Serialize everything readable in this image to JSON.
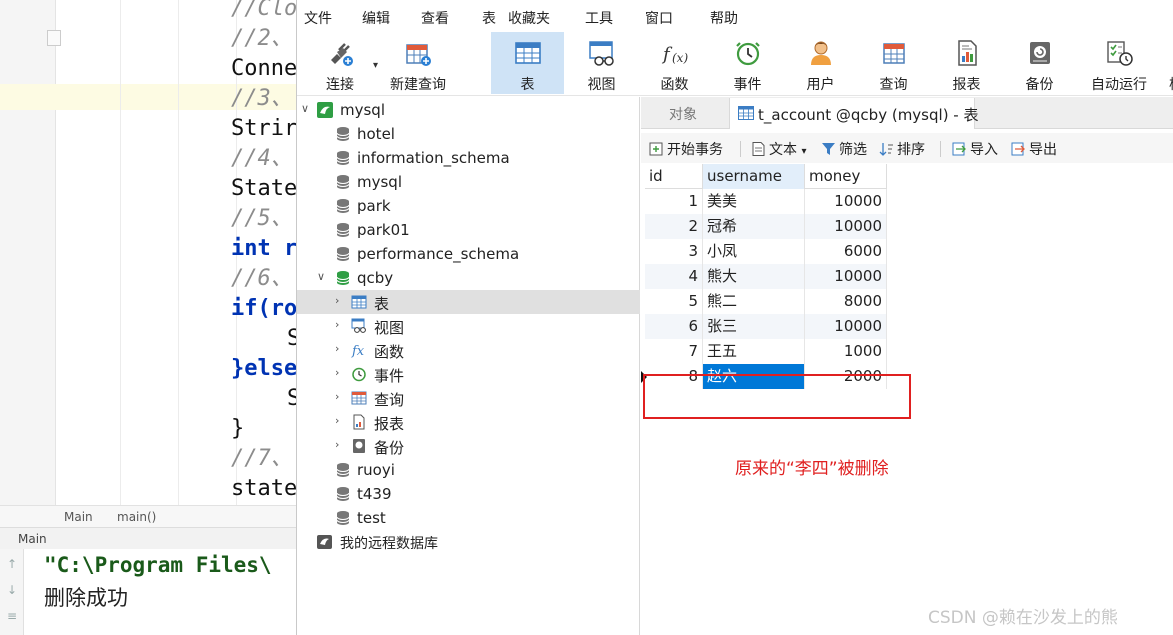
{
  "ide": {
    "code_lines": [
      "//Clo",
      "//2、",
      "Conne",
      "//3、",
      "Strir",
      "//4、",
      "State",
      "//5、",
      "int r",
      "//6、",
      "if(ro",
      "S",
      "}else",
      "S",
      "}",
      "//7、",
      "state"
    ],
    "breadcrumb": [
      "Main",
      "main()"
    ],
    "run_tab": "Main",
    "console_path": "\"C:\\Program Files\\",
    "console_msg": "删除成功"
  },
  "menubar": [
    "文件",
    "编辑",
    "查看",
    "表",
    "收藏夹",
    "工具",
    "窗口",
    "帮助"
  ],
  "toolbar": [
    {
      "label": "连接",
      "icon": "connect-icon"
    },
    {
      "label": "新建查询",
      "icon": "new-query-icon"
    },
    {
      "label": "表",
      "icon": "table-icon",
      "active": true
    },
    {
      "label": "视图",
      "icon": "view-icon"
    },
    {
      "label": "函数",
      "icon": "function-icon"
    },
    {
      "label": "事件",
      "icon": "event-clock-icon"
    },
    {
      "label": "用户",
      "icon": "user-icon"
    },
    {
      "label": "查询",
      "icon": "query-icon"
    },
    {
      "label": "报表",
      "icon": "report-icon"
    },
    {
      "label": "备份",
      "icon": "backup-icon"
    },
    {
      "label": "自动运行",
      "icon": "automation-icon"
    },
    {
      "label": "核",
      "icon": "model-icon"
    }
  ],
  "tree": {
    "connection": "mysql",
    "databases": [
      "hotel",
      "information_schema",
      "mysql",
      "park",
      "park01",
      "performance_schema",
      "qcby"
    ],
    "qcby_children": [
      "表",
      "视图",
      "函数",
      "事件",
      "查询",
      "报表",
      "备份"
    ],
    "databases_after": [
      "ruoyi",
      "t439",
      "test"
    ],
    "remote": "我的远程数据库"
  },
  "tabs": {
    "objects": "对象",
    "active_title": "t_account @qcby (mysql) - 表"
  },
  "subtoolbar": {
    "begin_tx": "开始事务",
    "text": "文本",
    "filter": "筛选",
    "sort": "排序",
    "import": "导入",
    "export": "导出"
  },
  "table": {
    "columns": [
      "id",
      "username",
      "money"
    ],
    "rows": [
      [
        "1",
        "美美",
        "10000"
      ],
      [
        "2",
        "冠希",
        "10000"
      ],
      [
        "3",
        "小凤",
        "6000"
      ],
      [
        "4",
        "熊大",
        "10000"
      ],
      [
        "5",
        "熊二",
        "8000"
      ],
      [
        "6",
        "张三",
        "10000"
      ],
      [
        "7",
        "王五",
        "1000"
      ],
      [
        "8",
        "赵六",
        "2000"
      ]
    ]
  },
  "annotation": "原来的“李四”被删除",
  "watermark": "CSDN @赖在沙发上的熊",
  "colors": {
    "accent": "#0078d7",
    "annotation": "#e02020",
    "active_tool": "#cfe3f6"
  }
}
